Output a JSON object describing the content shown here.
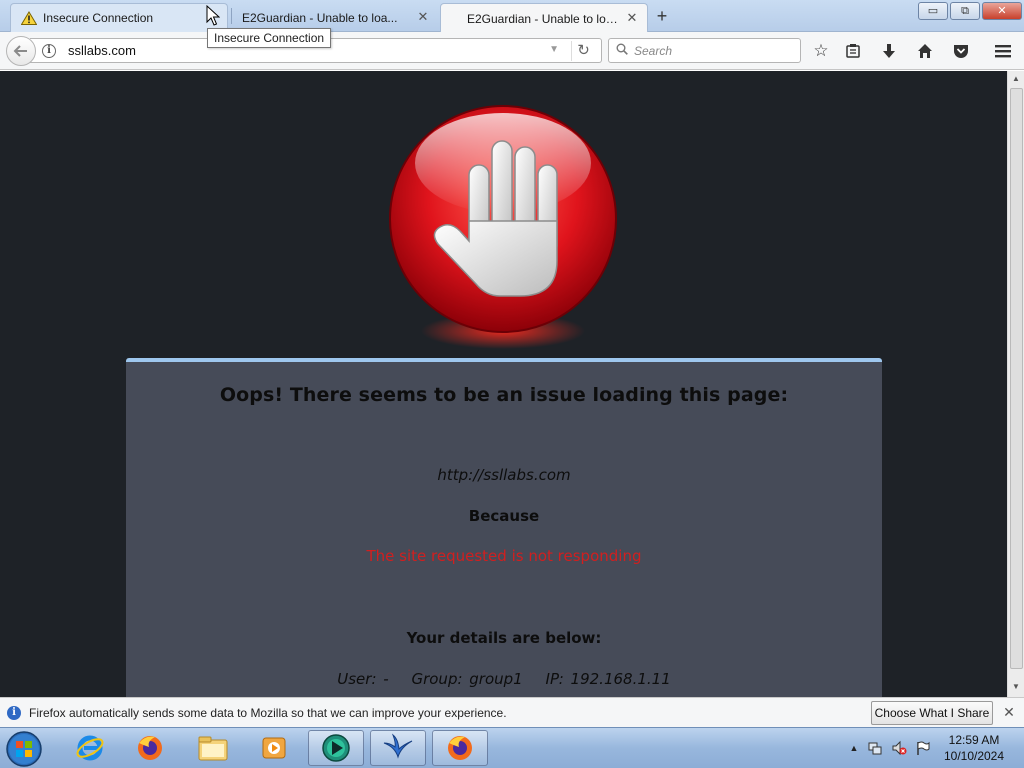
{
  "browser": {
    "tabs": [
      {
        "title": "Insecure Connection",
        "icon": "warning-icon",
        "active": false
      },
      {
        "title": "E2Guardian - Unable to loa...",
        "icon": "none",
        "active": false
      },
      {
        "title": "E2Guardian - Unable to loa...",
        "icon": "none",
        "active": true
      }
    ],
    "tooltip": "Insecure Connection",
    "url": "ssllabs.com",
    "search_placeholder": "Search",
    "window_buttons": {
      "minimize": "▭",
      "restore": "⧉",
      "close": "✕"
    }
  },
  "page": {
    "title": "Oops! There seems to be an issue loading this page:",
    "blocked_url": "http://ssllabs.com",
    "because_label": "Because",
    "reason": "The site requested is not responding",
    "details_label": "Your details are below:",
    "user": "User: -",
    "group": "Group: group1",
    "ip": "IP: 192.168.1.11",
    "colors": {
      "background": "#1e2227",
      "card": "#464b58",
      "card_border": "#9ec7ee",
      "reason_text": "#d11f1f",
      "stop_sign": "#d8131b"
    }
  },
  "notification": {
    "text": "Firefox automatically sends some data to Mozilla so that we can improve your experience.",
    "button": "Choose What I Share"
  },
  "taskbar": {
    "apps": [
      "internet-explorer-icon",
      "firefox-icon",
      "file-explorer-icon",
      "media-player-icon",
      "green-arrow-app-icon",
      "blue-bird-app-icon",
      "firefox-icon"
    ],
    "time": "12:59 AM",
    "date": "10/10/2024"
  }
}
